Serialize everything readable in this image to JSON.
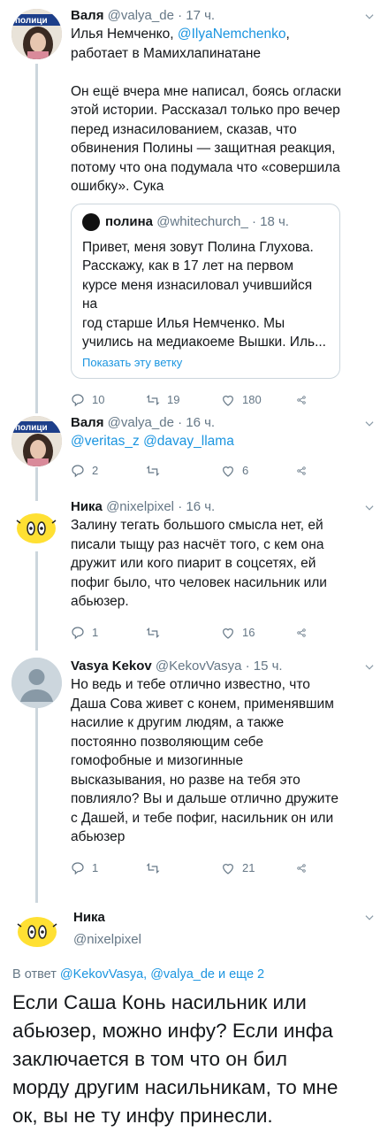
{
  "tweets": [
    {
      "name": "Валя",
      "handle": "@valya_de",
      "time": "17 ч.",
      "text_lines": [
        [
          {
            "t": "Илья Немченко, "
          },
          {
            "t": "@IlyaNemchenko",
            "m": true
          },
          {
            "t": ","
          }
        ],
        [
          {
            "t": "работает в Мамихлапинатане"
          }
        ],
        [
          {
            "t": ""
          }
        ],
        [
          {
            "t": "Он ещё вчера мне написал, боясь огласки"
          }
        ],
        [
          {
            "t": "этой истории. Рассказал только про вечер"
          }
        ],
        [
          {
            "t": "перед изнасилованием, сказав, что"
          }
        ],
        [
          {
            "t": "обвинения Полины — защитная реакция,"
          }
        ],
        [
          {
            "t": "потому что она подумала что «совершила"
          }
        ],
        [
          {
            "t": "ошибку». Сука"
          }
        ]
      ],
      "quote": {
        "name": "полина",
        "handle": "@whitechurch_",
        "time": "18 ч.",
        "lines": [
          "Привет, меня зовут Полина Глухова.",
          "Расскажу, как в 17 лет на первом",
          "курсе меня изнасиловал учившийся на",
          "год старше Илья Немченко. Мы",
          "учились на медиакоеме Вышки. Иль..."
        ],
        "link": "Показать эту ветку"
      },
      "replies": "10",
      "retweets": "19",
      "likes": "180"
    },
    {
      "name": "Валя",
      "handle": "@valya_de",
      "time": "16 ч.",
      "mentions": "@veritas_z @davay_llama",
      "replies": "2",
      "retweets": "",
      "likes": "6"
    },
    {
      "name": "Ника",
      "handle": "@nixelpixel",
      "time": "16 ч.",
      "lines": [
        "Залину тегать большого смысла нет, ей",
        "писали тыщу раз насчёт того, с кем она",
        "дружит или кого пиарит в соцсетях, ей",
        "пофиг было, что человек насильник или",
        "абьюзер."
      ],
      "replies": "1",
      "retweets": "",
      "likes": "16"
    },
    {
      "name": "Vasya Kekov",
      "handle": "@KekovVasya",
      "time": "15 ч.",
      "lines": [
        "Но ведь и тебе отлично известно, что",
        "Даша Сова живет с конем, применявшим",
        "насилие к другим людям, а также",
        "постоянно позволяющим себе",
        "гомофобные и мизогинные",
        "высказывания, но разве на тебя это",
        "повлияло? Вы и дальше отлично дружите",
        "с Дашей, и тебе пофиг, насильник он или",
        "абьюзер"
      ],
      "replies": "1",
      "retweets": "",
      "likes": "21"
    }
  ],
  "main": {
    "name": "Ника",
    "handle": "@nixelpixel",
    "reply_prefix": "В ответ ",
    "reply_to": "@KekovVasya, @valya_de и еще 2",
    "lines": [
      "Если Саша Конь насильник или",
      "абьюзер, можно инфу? Если инфа",
      "заключается в том что он бил",
      "морду другим насильникам, то мне",
      "ок, вы не ту инфу принесли."
    ]
  },
  "avatar_labels": {
    "valya": "полици"
  },
  "colors": {
    "link": "#1b95e0",
    "muted": "#657786",
    "line": "#ccd6dd",
    "nika_yellow": "#ffe033"
  }
}
